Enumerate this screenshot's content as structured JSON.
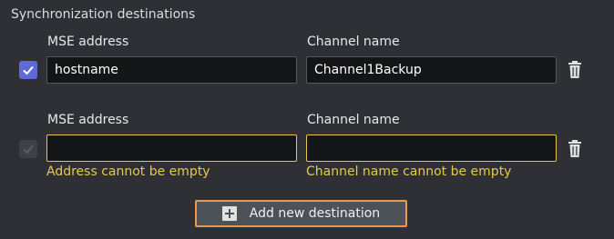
{
  "section": {
    "title": "Synchronization destinations"
  },
  "destinations": [
    {
      "checked": true,
      "address_label": "MSE address",
      "channel_label": "Channel name",
      "address_value": "hostname",
      "channel_value": "Channel1Backup",
      "address_error": "",
      "channel_error": ""
    },
    {
      "checked": true,
      "disabled": true,
      "address_label": "MSE address",
      "channel_label": "Channel name",
      "address_value": "",
      "channel_value": "",
      "address_error": "Address cannot be empty",
      "channel_error": "Channel name cannot be empty"
    }
  ],
  "add_button": {
    "label": "Add new destination",
    "icon": "plus-icon"
  },
  "colors": {
    "background": "#2e3036",
    "accent": "#5f6ad8",
    "error": "#e6c94a",
    "focus_outline": "#e99a4a"
  }
}
